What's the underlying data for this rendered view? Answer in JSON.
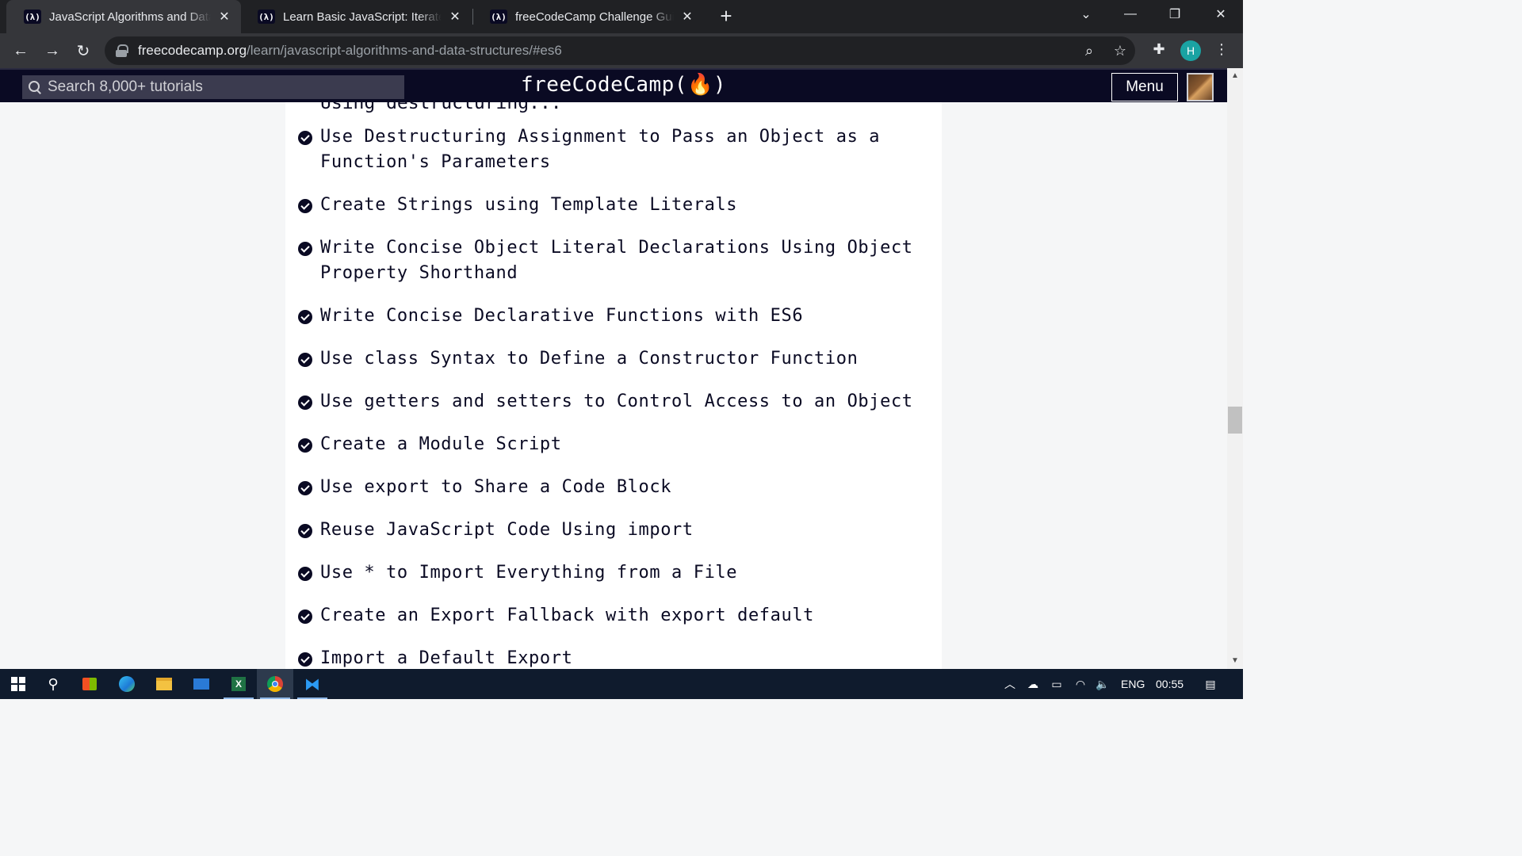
{
  "browser": {
    "tabs": [
      {
        "favicon": "(λ)",
        "title": "JavaScript Algorithms and Data Structures",
        "active": true
      },
      {
        "favicon": "(λ)",
        "title": "Learn Basic JavaScript: Iterate with",
        "active": false
      },
      {
        "favicon": "(λ)",
        "title": "freeCodeCamp Challenge Guide:",
        "active": false
      }
    ],
    "new_tab_label": "+",
    "url_host": "freecodecamp.org",
    "url_path": "/learn/javascript-algorithms-and-data-structures/#es6",
    "profile_initial": "H"
  },
  "fcc_nav": {
    "search_placeholder": "Search 8,000+ tutorials",
    "logo_text": "freeCodeCamp(🔥)",
    "menu_label": "Menu"
  },
  "content": {
    "cut_off_text": "Using destructuring...",
    "lessons": [
      "Use Destructuring Assignment to Pass an Object as a Function's Parameters",
      "Create Strings using Template Literals",
      "Write Concise Object Literal Declarations Using Object Property Shorthand",
      "Write Concise Declarative Functions with ES6",
      "Use class Syntax to Define a Constructor Function",
      "Use getters and setters to Control Access to an Object",
      "Create a Module Script",
      "Use export to Share a Code Block",
      "Reuse JavaScript Code Using import",
      "Use * to Import Everything from a File",
      "Create an Export Fallback with export default",
      "Import a Default Export"
    ]
  },
  "taskbar": {
    "language": "ENG",
    "time": "00:55"
  }
}
